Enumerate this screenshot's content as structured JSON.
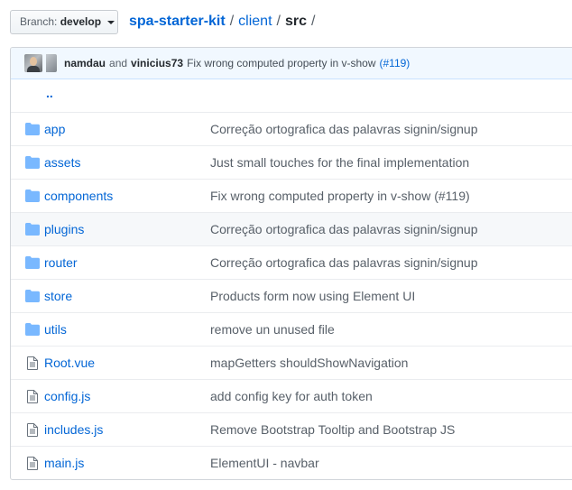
{
  "branch": {
    "label": "Branch:",
    "value": "develop"
  },
  "breadcrumb": {
    "repo": "spa-starter-kit",
    "path": [
      "client"
    ],
    "current": "src"
  },
  "latest_commit": {
    "author": "namdau",
    "connector": "and",
    "coauthor": "vinicius73",
    "message": "Fix wrong computed property in v-show",
    "ref": "(#119)"
  },
  "parent_link": "..",
  "colors": {
    "link": "#0366d6",
    "folder": "#79b8ff",
    "file": "#6a737d",
    "commit_bar": "#f1f8ff"
  },
  "files": [
    {
      "name": "app",
      "type": "folder-icon",
      "message": "Correção ortografica das palavras signin/signup"
    },
    {
      "name": "assets",
      "type": "folder-icon",
      "message": "Just small touches for the final implementation"
    },
    {
      "name": "components",
      "type": "folder-icon",
      "message": "Fix wrong computed property in v-show (#119)"
    },
    {
      "name": "plugins",
      "type": "folder-icon",
      "message": "Correção ortografica das palavras signin/signup"
    },
    {
      "name": "router",
      "type": "folder-icon",
      "message": "Correção ortografica das palavras signin/signup"
    },
    {
      "name": "store",
      "type": "folder-icon",
      "message": "Products form now using Element UI"
    },
    {
      "name": "utils",
      "type": "folder-icon",
      "message": "remove un unused file"
    },
    {
      "name": "Root.vue",
      "type": "file-icon",
      "message": "mapGetters shouldShowNavigation"
    },
    {
      "name": "config.js",
      "type": "file-icon",
      "message": "add config key for auth token"
    },
    {
      "name": "includes.js",
      "type": "file-icon",
      "message": "Remove Bootstrap Tooltip and Bootstrap JS"
    },
    {
      "name": "main.js",
      "type": "file-icon",
      "message": "ElementUI - navbar"
    }
  ]
}
